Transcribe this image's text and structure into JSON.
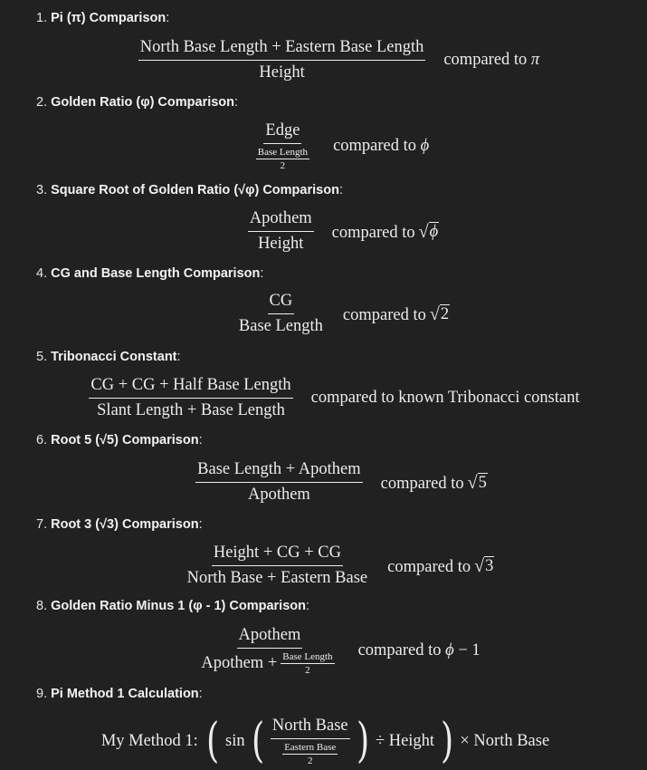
{
  "items": [
    {
      "num": "1.",
      "title": "Pi (π) Comparison",
      "colon": ":",
      "numerator": "North Base Length + Eastern Base Length",
      "denominator": "Height",
      "compare": "compared to",
      "symbol": "π"
    },
    {
      "num": "2.",
      "title": "Golden Ratio (φ) Comparison",
      "colon": ":",
      "numerator": "Edge",
      "den_num": "Base Length",
      "den_den": "2",
      "compare": "compared to",
      "symbol": "ϕ"
    },
    {
      "num": "3.",
      "title": "Square Root of Golden Ratio (√φ) Comparison",
      "colon": ":",
      "numerator": "Apothem",
      "denominator": "Height",
      "compare": "compared to",
      "symbol": "ϕ"
    },
    {
      "num": "4.",
      "title": "CG and Base Length Comparison",
      "colon": ":",
      "numerator": "CG",
      "denominator": "Base Length",
      "compare": "compared to",
      "symbol": "2"
    },
    {
      "num": "5.",
      "title": "Tribonacci Constant",
      "colon": ":",
      "numerator": "CG + CG + Half Base Length",
      "denominator": "Slant Length + Base Length",
      "compare": "compared to known Tribonacci constant"
    },
    {
      "num": "6.",
      "title": "Root 5 (√5) Comparison",
      "colon": ":",
      "numerator": "Base Length + Apothem",
      "denominator": "Apothem",
      "compare": "compared to",
      "symbol": "5"
    },
    {
      "num": "7.",
      "title": "Root 3 (√3) Comparison",
      "colon": ":",
      "numerator": "Height + CG + CG",
      "denominator": "North Base + Eastern Base",
      "compare": "compared to",
      "symbol": "3"
    },
    {
      "num": "8.",
      "title": "Golden Ratio Minus 1 (φ - 1) Comparison",
      "colon": ":",
      "numerator": "Apothem",
      "den_prefix": "Apothem +",
      "den_num": "Base Length",
      "den_den": "2",
      "compare": "compared to",
      "symbol": "ϕ",
      "suffix": "− 1"
    },
    {
      "num": "9.",
      "title": "Pi Method 1 Calculation",
      "colon": ":",
      "label": "My Method 1:",
      "func": "sin",
      "numerator": "North Base",
      "den_num": "Eastern Base",
      "den_den": "2",
      "divide": "÷ Height",
      "times": "× North Base"
    }
  ]
}
